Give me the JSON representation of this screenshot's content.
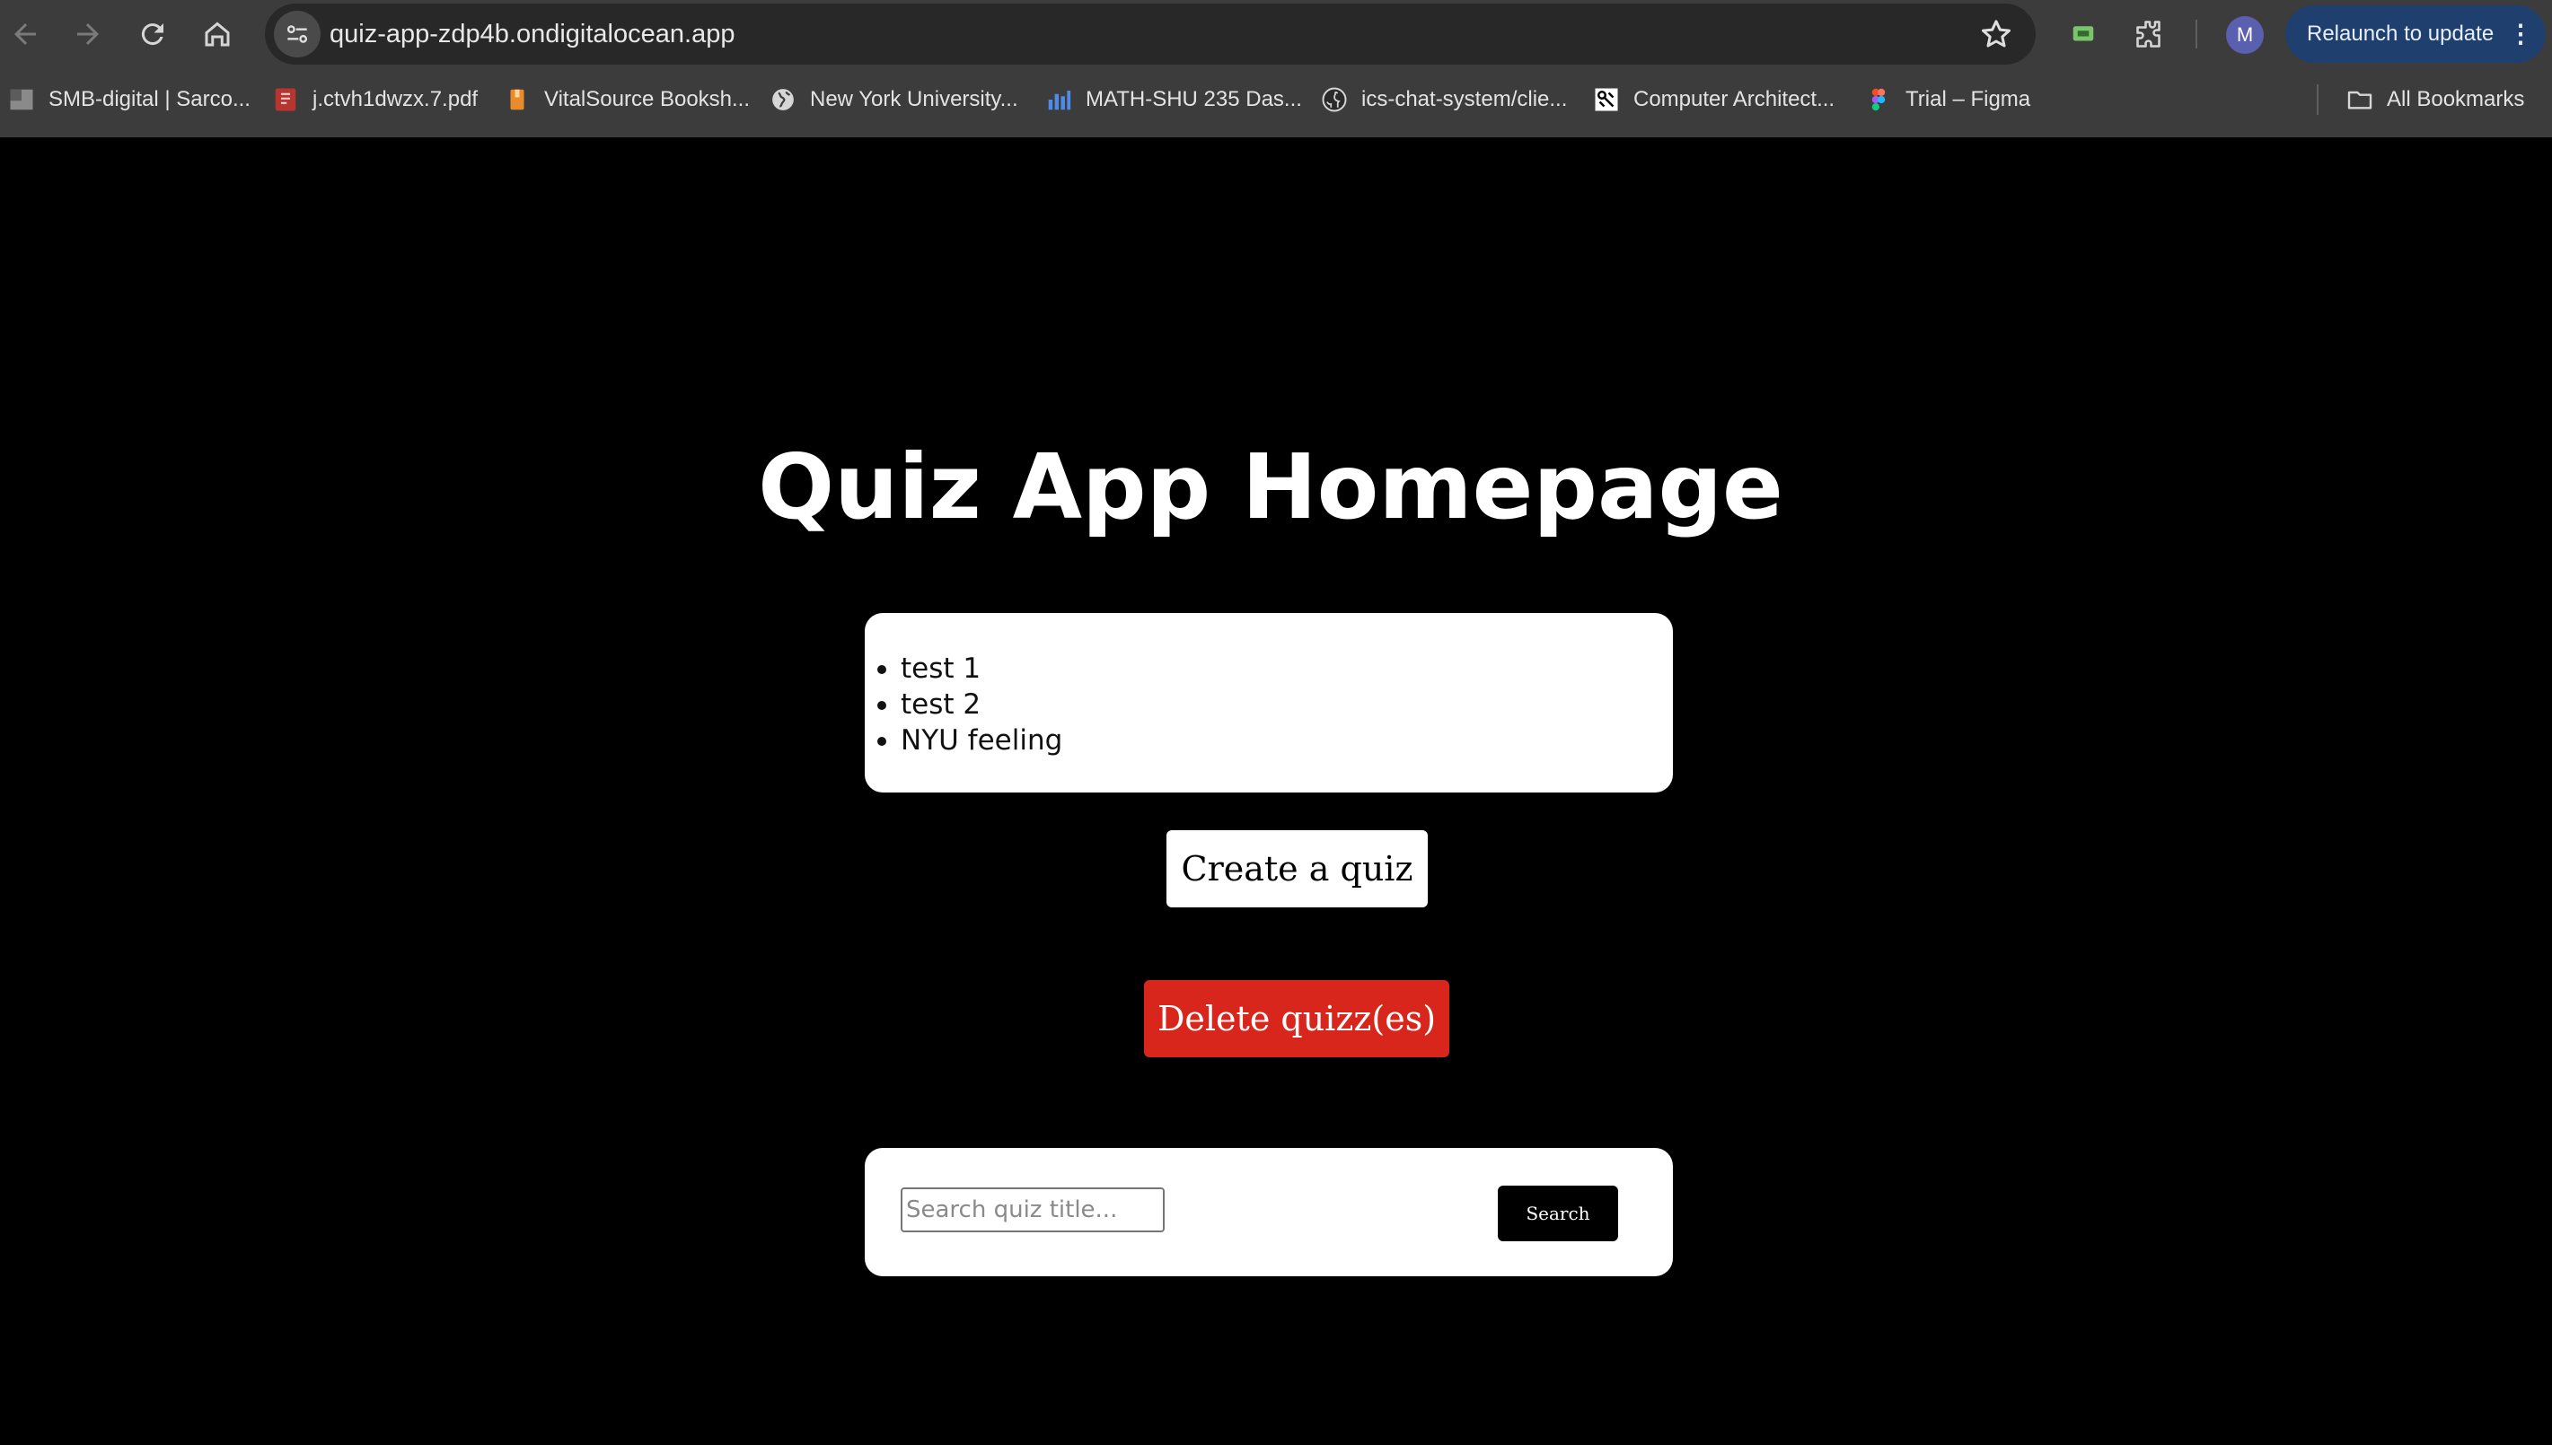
{
  "browser": {
    "url": "quiz-app-zdp4b.ondigitalocean.app",
    "profile_initial": "M",
    "relaunch_label": "Relaunch to update",
    "all_bookmarks_label": "All Bookmarks",
    "accent_color": "#1f3f6e",
    "bookmarks": [
      {
        "label": "SMB-digital | Sarco...",
        "icon": "page-icon"
      },
      {
        "label": "j.ctvh1dwzx.7.pdf",
        "icon": "pdf-icon"
      },
      {
        "label": "VitalSource Booksh...",
        "icon": "vitalsource-icon"
      },
      {
        "label": "New York University...",
        "icon": "globe-icon"
      },
      {
        "label": "MATH-SHU 235 Das...",
        "icon": "bar-chart-icon"
      },
      {
        "label": "ics-chat-system/clie...",
        "icon": "github-icon"
      },
      {
        "label": "Computer Architect...",
        "icon": "cpu-icon"
      },
      {
        "label": "Trial – Figma",
        "icon": "figma-icon"
      }
    ]
  },
  "page": {
    "title": "Quiz App Homepage",
    "quizzes": [
      "test 1",
      "test 2",
      "NYU feeling"
    ],
    "create_button_label": "Create a quiz",
    "delete_button_label": "Delete quizz(es)",
    "delete_button_color": "#d8261c",
    "search_placeholder": "Search quiz title...",
    "search_value": "",
    "search_button_label": "Search"
  }
}
